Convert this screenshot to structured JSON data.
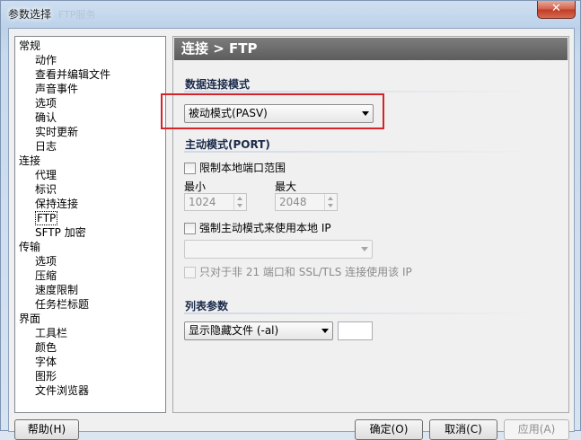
{
  "window": {
    "title": "参数选择",
    "title_ghost": "FTP服务",
    "close_symbol": "✕"
  },
  "sidebar": {
    "items": [
      {
        "label": "常规",
        "level": 0
      },
      {
        "label": "动作",
        "level": 1
      },
      {
        "label": "查看并编辑文件",
        "level": 1
      },
      {
        "label": "声音事件",
        "level": 1
      },
      {
        "label": "选项",
        "level": 1
      },
      {
        "label": "确认",
        "level": 1
      },
      {
        "label": "实时更新",
        "level": 1
      },
      {
        "label": "日志",
        "level": 1
      },
      {
        "label": "连接",
        "level": 0
      },
      {
        "label": "代理",
        "level": 1
      },
      {
        "label": "标识",
        "level": 1
      },
      {
        "label": "保持连接",
        "level": 1
      },
      {
        "label": "FTP",
        "level": 1,
        "selected": true
      },
      {
        "label": "SFTP 加密",
        "level": 1
      },
      {
        "label": "传输",
        "level": 0
      },
      {
        "label": "选项",
        "level": 1
      },
      {
        "label": "压缩",
        "level": 1
      },
      {
        "label": "速度限制",
        "level": 1
      },
      {
        "label": "任务栏标题",
        "level": 1
      },
      {
        "label": "界面",
        "level": 0
      },
      {
        "label": "工具栏",
        "level": 1
      },
      {
        "label": "颜色",
        "level": 1
      },
      {
        "label": "字体",
        "level": 1
      },
      {
        "label": "图形",
        "level": 1
      },
      {
        "label": "文件浏览器",
        "level": 1
      }
    ]
  },
  "panel": {
    "header": "连接 > FTP",
    "data_mode_title": "数据连接模式",
    "data_mode_value": "被动模式(PASV)",
    "active_mode_title": "主动模式(PORT)",
    "limit_ports_label": "限制本地端口范围",
    "min_label": "最小",
    "max_label": "最大",
    "min_value": "1024",
    "max_value": "2048",
    "force_ip_label": "强制主动模式来使用本地 IP",
    "ip_combo_value": "",
    "only_non21_label": "只对于非 21 端口和 SSL/TLS 连接使用该 IP",
    "list_params_title": "列表参数",
    "list_combo_value": "显示隐藏文件 (-al)",
    "list_extra_value": ""
  },
  "buttons": {
    "help": "帮助(H)",
    "ok": "确定(O)",
    "cancel": "取消(C)",
    "apply": "应用(A)"
  }
}
